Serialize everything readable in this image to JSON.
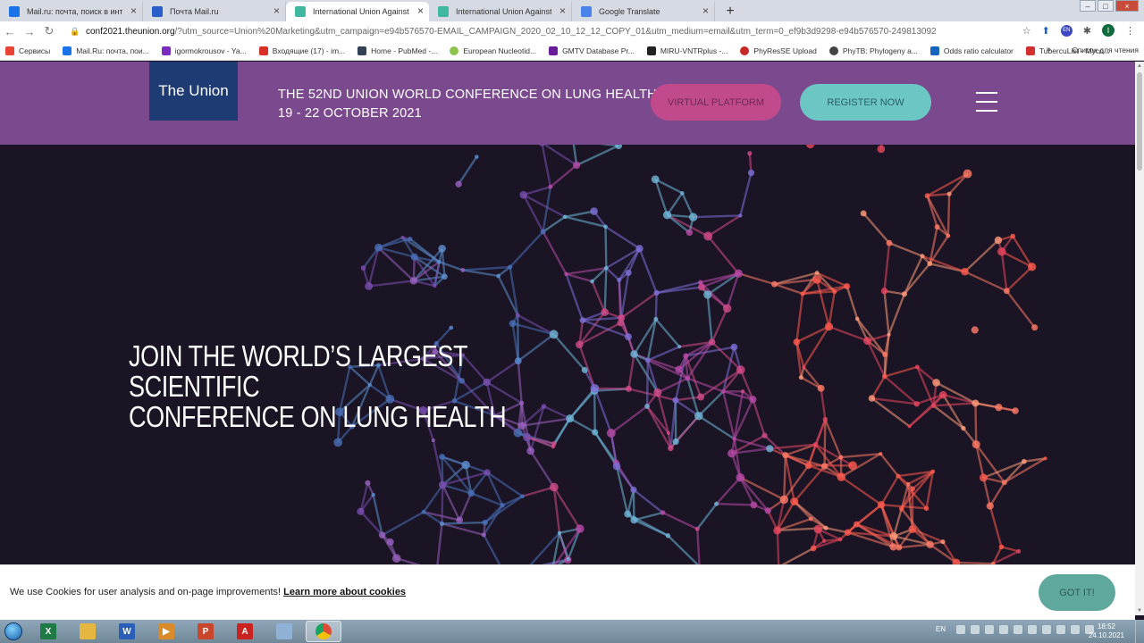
{
  "browser": {
    "tabs": [
      {
        "title": "Mail.ru: почта, поиск в интернете",
        "favicon_color": "#1a73e8",
        "active": false
      },
      {
        "title": "Почта Mail.ru",
        "favicon_color": "#2a5ec8",
        "active": false
      },
      {
        "title": "International Union Against Tuberculosis",
        "favicon_color": "#3fb89f",
        "active": true
      },
      {
        "title": "International Union Against Tuberculosis",
        "favicon_color": "#3fb89f",
        "active": false
      },
      {
        "title": "Google Translate",
        "favicon_color": "#4a83ea",
        "active": false
      }
    ],
    "new_tab": "+",
    "address": {
      "host": "conf2021.theunion.org",
      "rest": "/?utm_source=Union%20Marketing&utm_campaign=e94b576570-EMAIL_CAMPAIGN_2020_02_10_12_12_COPY_01&utm_medium=email&utm_term=0_ef9b3d9298-e94b576570-249813092"
    },
    "profile_initial": "I",
    "ext_label": "EN",
    "bookmarks": [
      {
        "label": "Сервисы",
        "color": "#e94335"
      },
      {
        "label": "Mail.Ru: почта, пои...",
        "color": "#1a73e8"
      },
      {
        "label": "igormokrousov - Ya...",
        "color": "#7b2cbf"
      },
      {
        "label": "Входящие (17) - im...",
        "color": "#d93025"
      },
      {
        "label": "Home - PubMed -...",
        "color": "#334155"
      },
      {
        "label": "European Nucleotid...",
        "color": "#8bc34a"
      },
      {
        "label": "GMTV Database Pr...",
        "color": "#6a1b9a"
      },
      {
        "label": "MIRU-VNTRplus -...",
        "color": "#222222"
      },
      {
        "label": "PhyResSE Upload",
        "color": "#c62828"
      },
      {
        "label": "PhyTB: Phylogeny a...",
        "color": "#444444"
      },
      {
        "label": "Odds ratio calculator",
        "color": "#1565c0"
      },
      {
        "label": "TubercuList - Myco...",
        "color": "#d32f2f"
      }
    ],
    "bookmarks_more": "»",
    "reading_list": "Список для чтения"
  },
  "site": {
    "logo": "The Union",
    "conference_line1": "THE 52ND UNION WORLD CONFERENCE ON LUNG HEALTH",
    "conference_line2": "19 - 22 OCTOBER 2021",
    "virtual_platform": "VIRTUAL PLATFORM",
    "register_now": "REGISTER NOW",
    "hero_line1": "JOIN THE WORLD’S LARGEST SCIENTIFIC",
    "hero_line2": "CONFERENCE ON LUNG HEALTH",
    "header_color": "#7b4a8e"
  },
  "cookie": {
    "text": "We use Cookies for user analysis and on-page improvements! ",
    "link": "Learn more about cookies",
    "button": "GOT IT!"
  },
  "taskbar": {
    "apps": [
      {
        "name": "excel",
        "glyph": "X",
        "color": "#1e7b45"
      },
      {
        "name": "explorer",
        "glyph": "",
        "color": "#e6b740"
      },
      {
        "name": "word",
        "glyph": "W",
        "color": "#2b5eb8"
      },
      {
        "name": "media",
        "glyph": "▶",
        "color": "#d98b2a"
      },
      {
        "name": "powerpoint",
        "glyph": "P",
        "color": "#c9452c"
      },
      {
        "name": "acrobat",
        "glyph": "A",
        "color": "#c8231f"
      },
      {
        "name": "notepad",
        "glyph": "",
        "color": "#8fb1d6"
      },
      {
        "name": "chrome",
        "glyph": "",
        "color": "#dd4b39"
      }
    ],
    "lang": "EN",
    "time": "18:52",
    "date": "24.10.2021"
  }
}
